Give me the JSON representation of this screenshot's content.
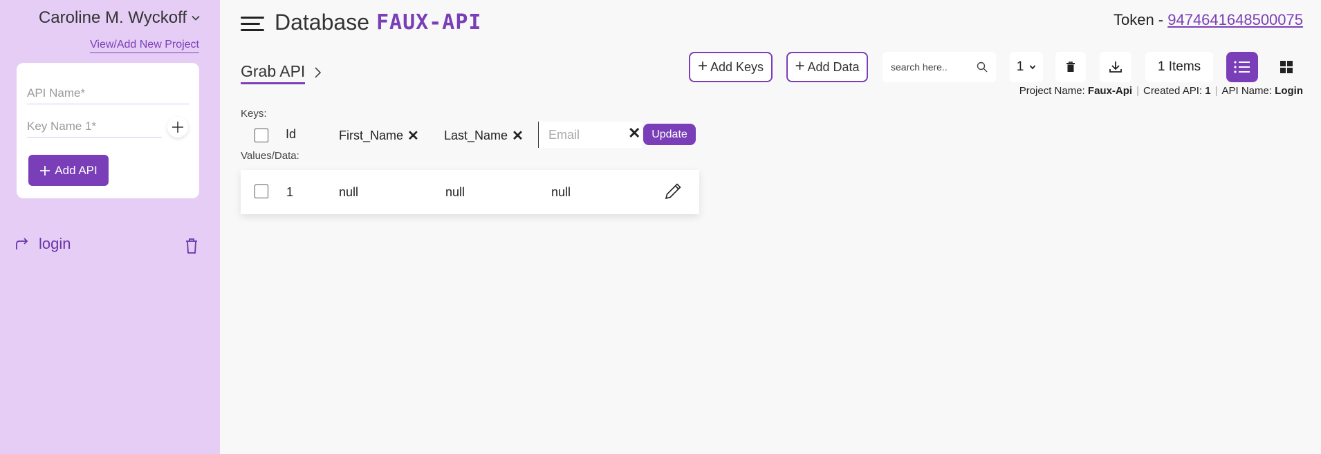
{
  "sidebar": {
    "user_name": "Caroline M. Wyckoff",
    "view_link": "View/Add New Project",
    "api_name_placeholder": "API Name*",
    "key_name_placeholder": "Key Name 1*",
    "add_api_label": "Add API",
    "apis": [
      {
        "label": "login"
      }
    ]
  },
  "header": {
    "title": "Database",
    "brand": "FAUX-API",
    "token_label": "Token - ",
    "token_value": "9474641648500075"
  },
  "breadcrumb": {
    "label": "Grab API"
  },
  "toolbar": {
    "add_keys_label": "Add Keys",
    "add_data_label": "Add Data",
    "search_placeholder": "search here..",
    "page_value": "1",
    "items_label": "1 Items"
  },
  "info": {
    "project_label": "Project Name:",
    "project_value": "Faux-Api",
    "created_label": "Created API:",
    "created_value": "1",
    "api_label": "API Name:",
    "api_value": "Login"
  },
  "keys": {
    "label": "Keys:",
    "columns": [
      "Id",
      "First_Name",
      "Last_Name"
    ],
    "new_key_placeholder": "Email",
    "update_label": "Update"
  },
  "values": {
    "label": "Values/Data:",
    "rows": [
      [
        "1",
        "null",
        "null",
        "null"
      ]
    ]
  },
  "colors": {
    "accent": "#7a3fb8",
    "sidebar_bg": "#e6cdf5"
  }
}
